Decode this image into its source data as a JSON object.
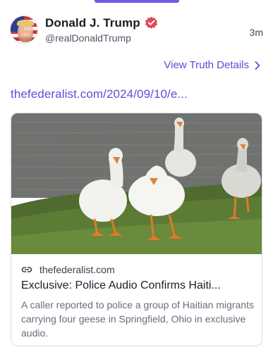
{
  "post": {
    "display_name": "Donald J. Trump",
    "handle": "@realDonaldTrump",
    "time": "3m",
    "view_details": "View Truth Details",
    "link": "thefederalist.com/2024/09/10/e..."
  },
  "card": {
    "domain": "thefederalist.com",
    "title": "Exclusive: Police Audio Confirms Haiti...",
    "description": "A caller reported to police a group of Haitian migrants carrying four geese in Springfield, Ohio in exclusive audio."
  },
  "colors": {
    "accent": "#5a4fd6",
    "verified": "#e04a57",
    "indicator": "#6b5ce7"
  },
  "icons": {
    "verified": "verified-badge-icon",
    "chevron": "chevron-right-icon",
    "link": "link-icon"
  }
}
